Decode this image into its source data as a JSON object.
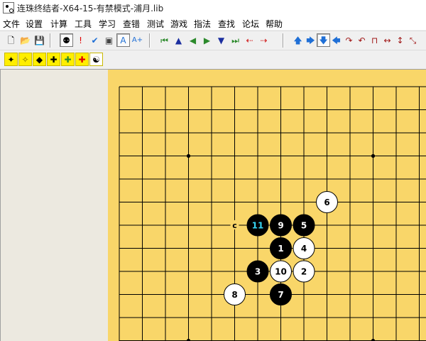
{
  "window": {
    "title": "连珠终结者-X64-15-有禁模式-浦月.lib"
  },
  "menu": [
    "文件",
    "设置",
    "计算",
    "工具",
    "学习",
    "查错",
    "测试",
    "游戏",
    "指法",
    "查找",
    "论坛",
    "帮助"
  ],
  "toolbar1": [
    {
      "name": "new-file",
      "glyph": "🗋",
      "color": "#000000"
    },
    {
      "name": "open-folder",
      "glyph": "📂",
      "color": "#c89b2a"
    },
    {
      "name": "save",
      "glyph": "💾",
      "color": "#555555"
    },
    {
      "name": "stones",
      "glyph": "⚉",
      "color": "#000000",
      "pressed": true
    },
    {
      "name": "exclamation",
      "glyph": "!",
      "color": "#e00000"
    },
    {
      "name": "check",
      "glyph": "✔",
      "color": "#1f6fd6"
    },
    {
      "name": "image",
      "glyph": "▣",
      "color": "#444444"
    },
    {
      "name": "font-a",
      "glyph": "A",
      "color": "#1f6fd6",
      "pressed": true
    },
    {
      "name": "font-a-plus",
      "glyph": "A+",
      "color": "#1f6fd6"
    },
    {
      "name": "first-move",
      "glyph": "⏮",
      "color": "#2c8a2c"
    },
    {
      "name": "up-triangle",
      "glyph": "▲",
      "color": "#1c2fa0"
    },
    {
      "name": "left-triangle",
      "glyph": "◀",
      "color": "#2c8a2c"
    },
    {
      "name": "right-triangle",
      "glyph": "▶",
      "color": "#2c8a2c"
    },
    {
      "name": "down-triangle",
      "glyph": "▼",
      "color": "#1c2fa0"
    },
    {
      "name": "last-move",
      "glyph": "⏭",
      "color": "#2c8a2c"
    },
    {
      "name": "branch-left",
      "glyph": "⇠",
      "color": "#d01818"
    },
    {
      "name": "branch-right",
      "glyph": "⇢",
      "color": "#d01818"
    },
    {
      "name": "arrow-up",
      "glyph": "🡅",
      "color": "#1f6fd6"
    },
    {
      "name": "arrow-right",
      "glyph": "🡆",
      "color": "#1f6fd6"
    },
    {
      "name": "arrow-down",
      "glyph": "🡇",
      "color": "#1f6fd6",
      "pressed": true
    },
    {
      "name": "arrow-left",
      "glyph": "🡄",
      "color": "#1f6fd6"
    },
    {
      "name": "rotate-cw",
      "glyph": "↷",
      "color": "#a01818"
    },
    {
      "name": "rotate-ccw",
      "glyph": "↶",
      "color": "#a01818"
    },
    {
      "name": "flip-u",
      "glyph": "⊓",
      "color": "#a01818"
    },
    {
      "name": "flip-horizontal",
      "glyph": "↔",
      "color": "#a01818"
    },
    {
      "name": "flip-vertical",
      "glyph": "↕",
      "color": "#a01818"
    },
    {
      "name": "diagonal-swap",
      "glyph": "⤡",
      "color": "#a01818"
    }
  ],
  "toolbar2": [
    {
      "name": "sparkle-star",
      "glyph": "✦",
      "color": "#000000",
      "bg": "#ffee00"
    },
    {
      "name": "dotted-star",
      "glyph": "✧",
      "color": "#7a6a00",
      "bg": "#ffee00"
    },
    {
      "name": "black-diamond",
      "glyph": "◆",
      "color": "#000000",
      "bg": "#ffee00"
    },
    {
      "name": "yellow-cross",
      "glyph": "✚",
      "color": "#000000",
      "bg": "#ffee00"
    },
    {
      "name": "green-cross",
      "glyph": "✚",
      "color": "#2c8a2c",
      "bg": "#ffee00"
    },
    {
      "name": "red-cross",
      "glyph": "✚",
      "color": "#e00000",
      "bg": "#ffee00"
    },
    {
      "name": "yin-yang",
      "glyph": "☯",
      "color": "#000000",
      "bg": "#ffffff"
    }
  ],
  "board": {
    "grid_color": "#000000",
    "background": "#f9d669",
    "star_points": [
      [
        3,
        3
      ],
      [
        11,
        3
      ],
      [
        3,
        11
      ],
      [
        11,
        11
      ]
    ],
    "stones": [
      {
        "label": "1",
        "color": "black",
        "col": 7,
        "row": 7
      },
      {
        "label": "2",
        "color": "white",
        "col": 8,
        "row": 8
      },
      {
        "label": "3",
        "color": "black",
        "col": 6,
        "row": 8
      },
      {
        "label": "4",
        "color": "white",
        "col": 8,
        "row": 7
      },
      {
        "label": "5",
        "color": "black",
        "col": 8,
        "row": 6
      },
      {
        "label": "6",
        "color": "white",
        "col": 9,
        "row": 5
      },
      {
        "label": "7",
        "color": "black",
        "col": 7,
        "row": 9
      },
      {
        "label": "8",
        "color": "white",
        "col": 5,
        "row": 9
      },
      {
        "label": "9",
        "color": "black",
        "col": 7,
        "row": 6
      },
      {
        "label": "10",
        "color": "white",
        "col": 7,
        "row": 8
      },
      {
        "label": "11",
        "color": "black",
        "col": 6,
        "row": 6,
        "last": true,
        "label_color": "#36d4f4"
      }
    ],
    "marks": [
      {
        "label": "c",
        "col": 5,
        "row": 6
      }
    ]
  }
}
